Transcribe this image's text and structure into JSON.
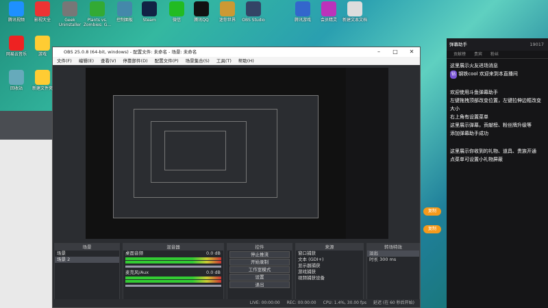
{
  "desktop_icons": [
    "腾讯视频",
    "影视大全",
    "Geek Uninstaller",
    "Plants vs. Zombies: G...",
    "控制面板",
    "Steam",
    "微信",
    "腾讯QQ",
    "迷你世界",
    "OBS Studio",
    "腾讯游戏",
    "会员精灵",
    "新建文本文档",
    "网易云音乐",
    "游戏",
    "回收站",
    "新建文件夹"
  ],
  "obs": {
    "title": "OBS 25.0.8 (64-bit, windows) - 配置文件: 未命名 - 场景: 未命名",
    "menu": [
      "文件(F)",
      "编辑(E)",
      "查看(V)",
      "停靠部件(D)",
      "配置文件(P)",
      "场景集合(S)",
      "工具(T)",
      "帮助(H)"
    ],
    "docks": {
      "scenes": {
        "title": "场景",
        "items": [
          "场景",
          "场景 2"
        ]
      },
      "mixer": {
        "title": "混音器",
        "tracks": [
          {
            "name": "桌面音频",
            "db": "0.0 dB"
          },
          {
            "name": "麦克风/Aux",
            "db": "0.0 dB"
          }
        ]
      },
      "controls": {
        "title": "控件",
        "buttons": [
          "停止推流",
          "开始录制",
          "工作室模式",
          "设置",
          "退出"
        ]
      },
      "sources": {
        "title": "来源",
        "items": [
          "窗口捕获",
          "文本 (GDI+)",
          "显示器捕获",
          "游戏捕获",
          "视频捕获设备"
        ]
      },
      "transitions": {
        "title": "转场特效",
        "type": "淡出",
        "duration_label": "时长",
        "duration": "300 ms"
      }
    },
    "status": [
      "LIVE: 00:00:00",
      "REC: 00:00:00",
      "CPU: 1.4%, 30.00 fps",
      "延迟 (在 60 秒后开始)"
    ]
  },
  "assistant": {
    "title": "弹幕助手",
    "tabs": [
      "贡献榜",
      "贵宾",
      "粉丝"
    ],
    "count": "19017",
    "messages": [
      "这里展示火友进场消息",
      "欢迎来到本直播间",
      "欢迎使用斗鱼弹幕助手",
      "左键拖拽顶部改变位置，左键拉伸边框改变大小",
      "右上角有设置菜单",
      "这里展示弹幕，贡献榜、粉丝牌升级等",
      "添加弹幕助手成功",
      "这里展示你收到的礼物、道具、贵族开通",
      "点菜单可设置小礼物屏蔽"
    ],
    "badge": "钻",
    "user": "钢铁cool"
  },
  "orange_buttons": [
    "复制",
    "复制"
  ]
}
